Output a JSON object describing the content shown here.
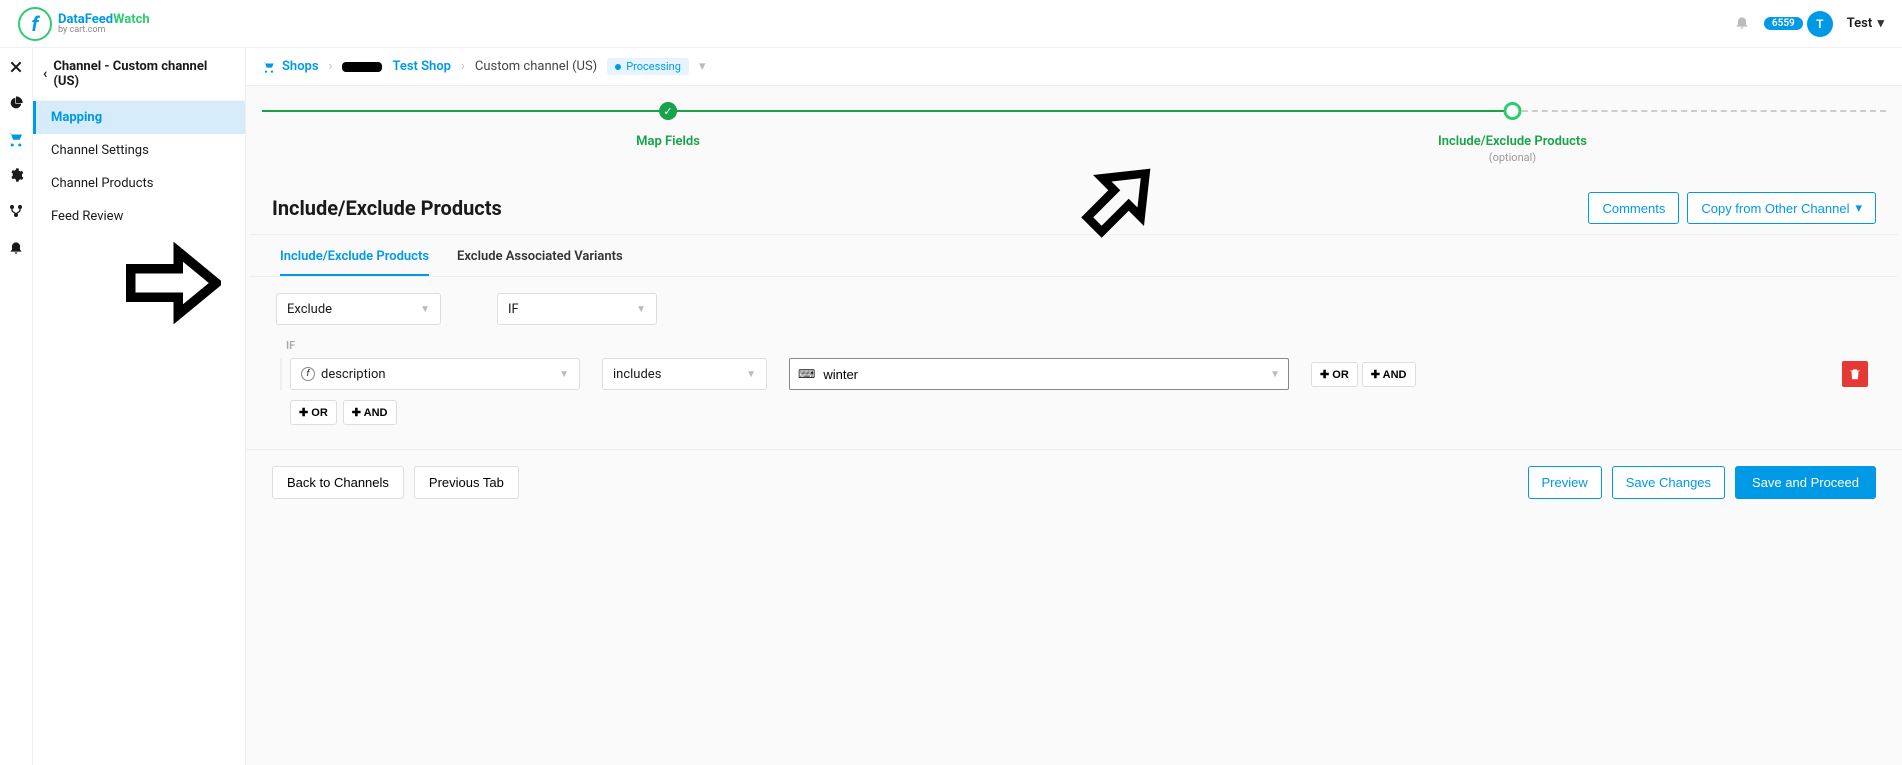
{
  "header": {
    "logo_brand1": "DataFeed",
    "logo_brand2": "Watch",
    "logo_sub": "by cart.com",
    "badge": "6559",
    "avatar_letter": "T",
    "user_name": "Test"
  },
  "sidebar": {
    "title": "Channel - Custom channel (US)",
    "items": [
      "Mapping",
      "Channel Settings",
      "Channel Products",
      "Feed Review"
    ]
  },
  "crumbs": {
    "shops": "Shops",
    "shop_name": "Test Shop",
    "channel": "Custom channel (US)",
    "status": "Processing"
  },
  "stepper": {
    "step1": "Map Fields",
    "step2": "Include/Exclude Products",
    "step2_sub": "(optional)"
  },
  "section": {
    "title": "Include/Exclude Products",
    "btn_comments": "Comments",
    "btn_copy": "Copy from Other Channel"
  },
  "tabs": {
    "t1": "Include/Exclude Products",
    "t2": "Exclude Associated Variants"
  },
  "rule": {
    "action": "Exclude",
    "cond_type": "IF",
    "if_label": "IF",
    "field": "description",
    "operator": "includes",
    "value": "winter",
    "or_btn": "OR",
    "and_btn": "AND"
  },
  "footer": {
    "back": "Back to Channels",
    "prev": "Previous Tab",
    "preview": "Preview",
    "save": "Save Changes",
    "proceed": "Save and Proceed"
  }
}
